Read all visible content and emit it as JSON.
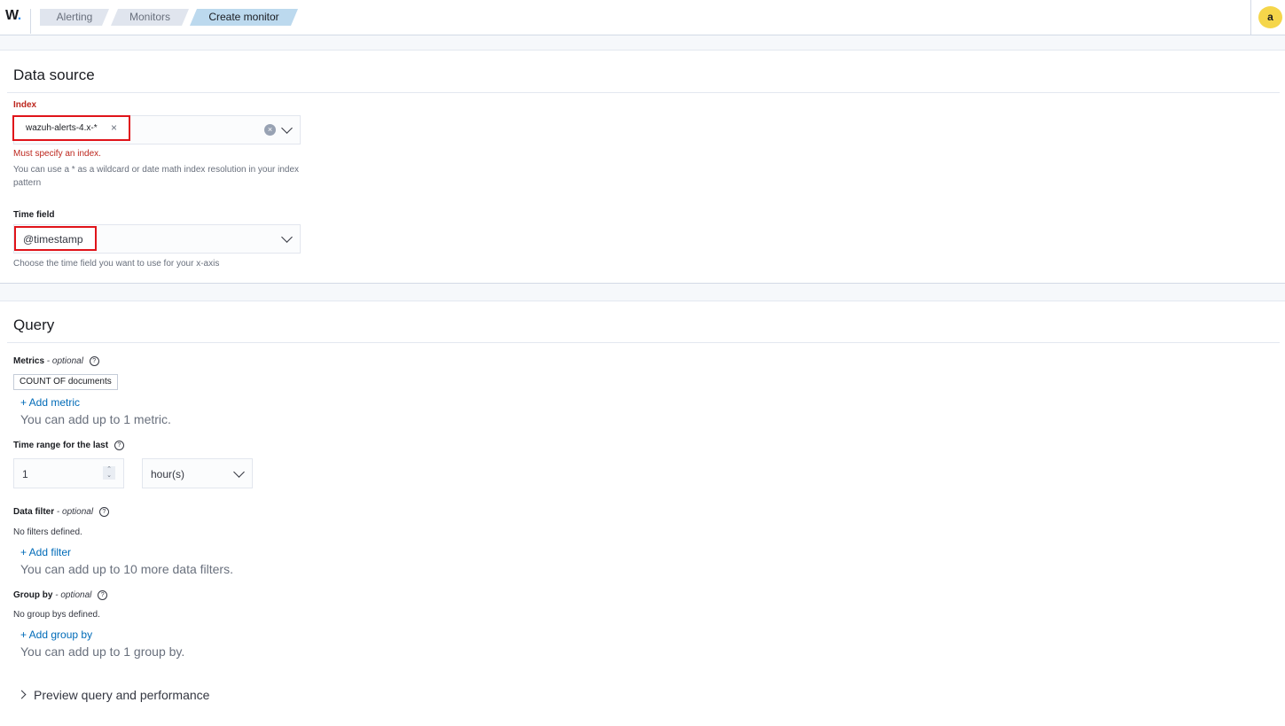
{
  "header": {
    "logo_text": "W",
    "logo_dot": ".",
    "breadcrumbs": [
      "Alerting",
      "Monitors",
      "Create monitor"
    ],
    "avatar_initial": "a"
  },
  "data_source": {
    "title": "Data source",
    "index": {
      "label": "Index",
      "selected": "wazuh-alerts-4.x-*",
      "error": "Must specify an index.",
      "help": "You can use a * as a wildcard or date math index resolution in your index pattern"
    },
    "time_field": {
      "label": "Time field",
      "value": "@timestamp",
      "help": "Choose the time field you want to use for your x-axis"
    }
  },
  "query": {
    "title": "Query",
    "metrics": {
      "label": "Metrics",
      "optional": "- optional",
      "badge": "COUNT OF documents",
      "add_link": "+ Add metric",
      "note": "You can add up to 1 metric."
    },
    "time_range": {
      "label": "Time range for the last",
      "value": "1",
      "unit": "hour(s)"
    },
    "data_filter": {
      "label": "Data filter",
      "optional": "- optional",
      "empty": "No filters defined.",
      "add_link": "+ Add filter",
      "note": "You can add up to 10 more data filters."
    },
    "group_by": {
      "label": "Group by",
      "optional": "- optional",
      "empty": "No group bys defined.",
      "add_link": "+ Add group by",
      "note": "You can add up to 1 group by."
    },
    "preview": "Preview query and performance"
  },
  "colors": {
    "accent": "#006bb8",
    "error": "#bd271e",
    "highlight_box": "#e0141a",
    "avatar": "#f5d64a",
    "active_crumb": "#bcd9ee"
  },
  "icons": [
    "help-circle-icon",
    "clear-icon",
    "chevron-down-icon",
    "chevron-right-icon",
    "close-icon",
    "spinner-icon"
  ]
}
